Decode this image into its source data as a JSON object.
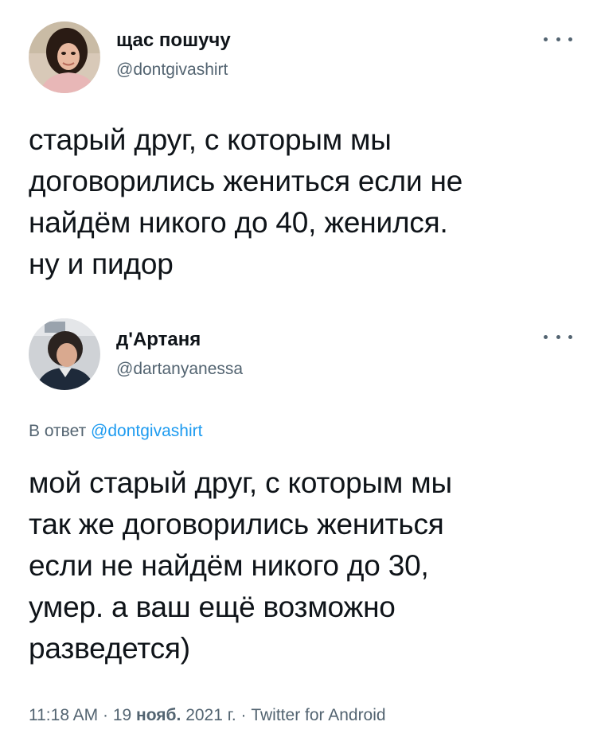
{
  "original_tweet": {
    "display_name": "щас пошучу",
    "handle": "@dontgivashirt",
    "text_lines": [
      "старый друг, с которым мы",
      "договорились жениться если не",
      "найдём никого до 40, женился.",
      "ну и пидор"
    ]
  },
  "reply_tweet": {
    "display_name": "д'Артаня",
    "handle": "@dartanyanessa",
    "reply_prefix": "В ответ",
    "reply_mention": "@dontgivashirt",
    "text_lines": [
      "мой старый друг, с которым мы",
      "так же договорились жениться",
      "если не найдём никого до 30,",
      "умер. а ваш ещё возможно",
      "разведется)"
    ],
    "meta": {
      "time": "11:18 AM",
      "sep1": " · ",
      "day": "19",
      "month": "нояб.",
      "year": "2021 г.",
      "sep2": " · ",
      "client": "Twitter for Android"
    }
  },
  "icons": {
    "more": "more-horizontal-icon"
  },
  "colors": {
    "text": "#0f1419",
    "secondary": "#536471",
    "link": "#1d9bf0"
  }
}
